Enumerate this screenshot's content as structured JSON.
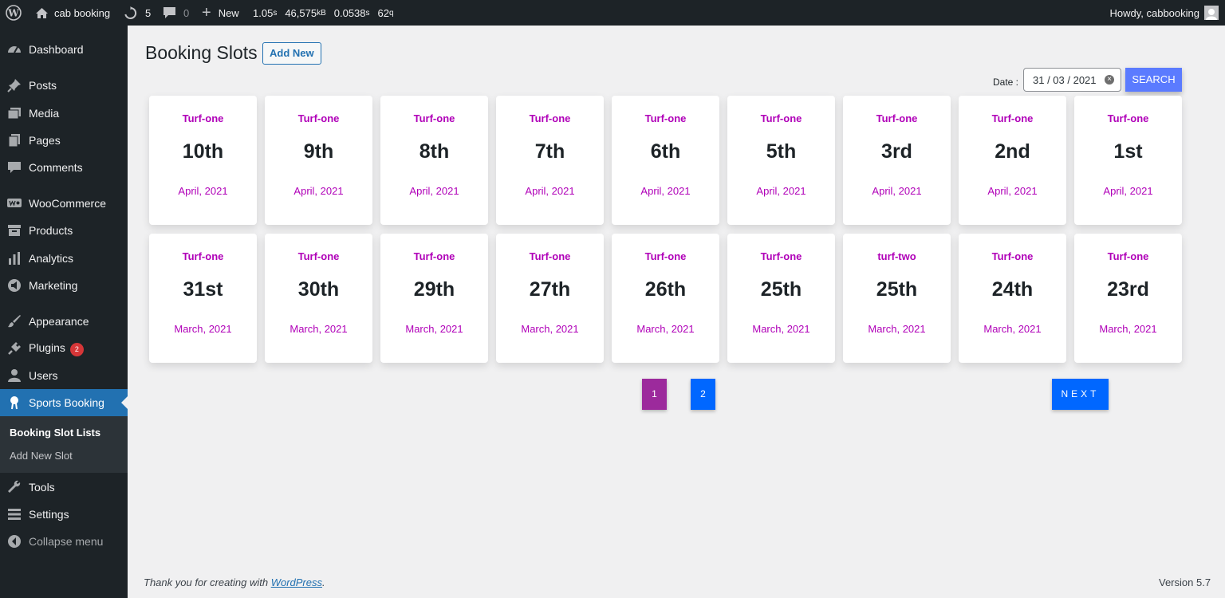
{
  "adminbar": {
    "site_name": "cab booking",
    "updates_count": "5",
    "comments_count": "0",
    "new_label": "New",
    "query_time": "1.05",
    "query_time_unit": "s",
    "memory": "46,575",
    "memory_unit": "kB",
    "query_time2": "0.0538",
    "query_time2_unit": "s",
    "queries": "62",
    "queries_unit": "q",
    "howdy": "Howdy, cabbooking"
  },
  "sidebar": {
    "items": [
      {
        "label": "Dashboard",
        "icon": "dashboard-icon"
      },
      {
        "label": "Posts",
        "icon": "pin-icon"
      },
      {
        "label": "Media",
        "icon": "media-icon"
      },
      {
        "label": "Pages",
        "icon": "pages-icon"
      },
      {
        "label": "Comments",
        "icon": "comment-icon"
      },
      {
        "label": "WooCommerce",
        "icon": "woo-icon"
      },
      {
        "label": "Products",
        "icon": "archive-icon"
      },
      {
        "label": "Analytics",
        "icon": "bar-chart-icon"
      },
      {
        "label": "Marketing",
        "icon": "megaphone-icon"
      },
      {
        "label": "Appearance",
        "icon": "brush-icon"
      },
      {
        "label": "Plugins",
        "icon": "plug-icon",
        "badge": "2"
      },
      {
        "label": "Users",
        "icon": "user-icon"
      },
      {
        "label": "Sports Booking",
        "icon": "sports-icon"
      },
      {
        "label": "Tools",
        "icon": "wrench-icon"
      },
      {
        "label": "Settings",
        "icon": "settings-icon"
      },
      {
        "label": "Collapse menu",
        "icon": "collapse-icon"
      }
    ],
    "submenu": [
      "Booking Slot Lists",
      "Add New Slot"
    ]
  },
  "main": {
    "title": "Booking Slots",
    "add_new": "Add New",
    "date_label": "Date :",
    "date_value": "31 / 03 / 2021",
    "search_label": "SEARCH",
    "cards": [
      {
        "turf": "Turf-one",
        "day": "10th",
        "month": "April, 2021"
      },
      {
        "turf": "Turf-one",
        "day": "9th",
        "month": "April, 2021"
      },
      {
        "turf": "Turf-one",
        "day": "8th",
        "month": "April, 2021"
      },
      {
        "turf": "Turf-one",
        "day": "7th",
        "month": "April, 2021"
      },
      {
        "turf": "Turf-one",
        "day": "6th",
        "month": "April, 2021"
      },
      {
        "turf": "Turf-one",
        "day": "5th",
        "month": "April, 2021"
      },
      {
        "turf": "Turf-one",
        "day": "3rd",
        "month": "April, 2021"
      },
      {
        "turf": "Turf-one",
        "day": "2nd",
        "month": "April, 2021"
      },
      {
        "turf": "Turf-one",
        "day": "1st",
        "month": "April, 2021"
      },
      {
        "turf": "Turf-one",
        "day": "31st",
        "month": "March, 2021"
      },
      {
        "turf": "Turf-one",
        "day": "30th",
        "month": "March, 2021"
      },
      {
        "turf": "Turf-one",
        "day": "29th",
        "month": "March, 2021"
      },
      {
        "turf": "Turf-one",
        "day": "27th",
        "month": "March, 2021"
      },
      {
        "turf": "Turf-one",
        "day": "26th",
        "month": "March, 2021"
      },
      {
        "turf": "Turf-one",
        "day": "25th",
        "month": "March, 2021"
      },
      {
        "turf": "turf-two",
        "day": "25th",
        "month": "March, 2021"
      },
      {
        "turf": "Turf-one",
        "day": "24th",
        "month": "March, 2021"
      },
      {
        "turf": "Turf-one",
        "day": "23rd",
        "month": "March, 2021"
      }
    ],
    "pagination": {
      "page1": "1",
      "page2": "2",
      "next": "NEXT"
    }
  },
  "footer": {
    "thanks_prefix": "Thank you for creating with ",
    "thanks_link": "WordPress",
    "thanks_suffix": ".",
    "version": "Version 5.7"
  },
  "colors": {
    "admin_bg": "#1d2327",
    "accent": "#2271b1",
    "turf_text": "#b000b8",
    "search_btn": "#5b7bff",
    "page_active": "#9c2a9c",
    "page_btn": "#0067ff"
  }
}
